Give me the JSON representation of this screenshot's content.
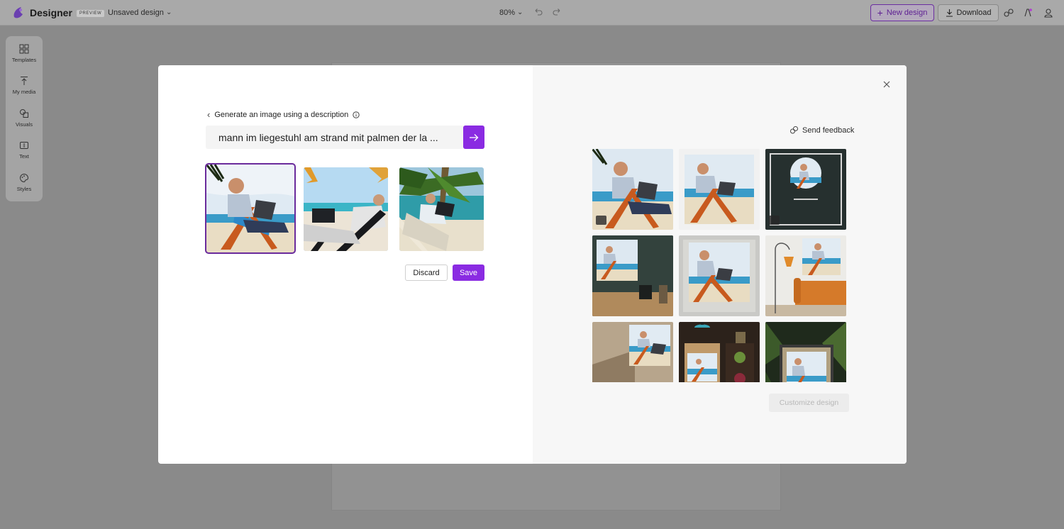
{
  "app": {
    "brand": "Designer",
    "badge": "PREVIEW",
    "doc_name": "Unsaved design",
    "zoom": "80%",
    "new_design_label": "New design",
    "download_label": "Download"
  },
  "sidebar": {
    "items": [
      {
        "label": "Templates",
        "icon": "templates-icon"
      },
      {
        "label": "My media",
        "icon": "upload-icon"
      },
      {
        "label": "Visuals",
        "icon": "shapes-icon"
      },
      {
        "label": "Text",
        "icon": "text-icon"
      },
      {
        "label": "Styles",
        "icon": "palette-icon"
      }
    ]
  },
  "generator": {
    "back_label": "Generate an image using a description",
    "prompt": "mann im liegestuhl am strand mit palmen der la ...",
    "discard_label": "Discard",
    "save_label": "Save",
    "selected_index": 0
  },
  "designs": {
    "feedback_label": "Send feedback",
    "customize_label": "Customize design"
  },
  "colors": {
    "accent": "#8a2be2",
    "accent_dark": "#6a2b9c"
  }
}
